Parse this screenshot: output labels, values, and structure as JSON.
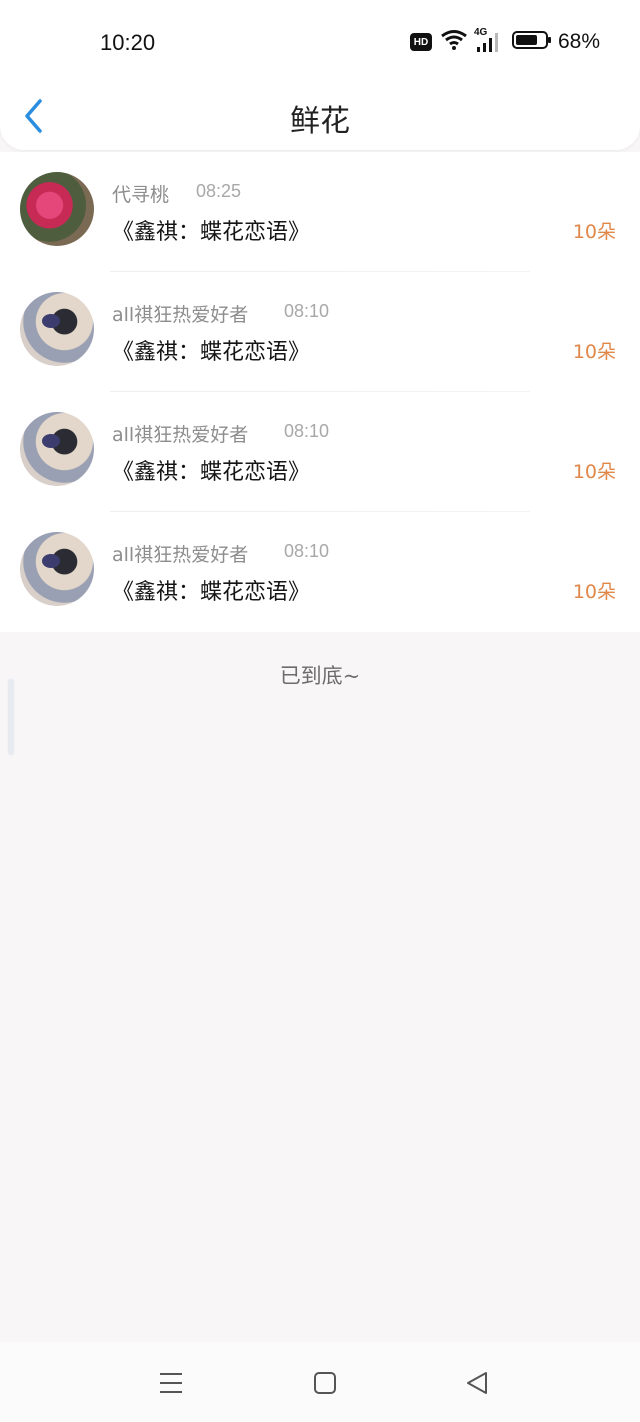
{
  "status_bar": {
    "time": "10:20",
    "hd_badge": "HD",
    "network": "4G",
    "battery": "68%",
    "icons": [
      "wifi-icon",
      "signal-icon",
      "battery-icon"
    ]
  },
  "header": {
    "back_icon": "chevron-left-icon",
    "title": "鲜花",
    "accent_color": "#2b8de0"
  },
  "records": [
    {
      "name": "代寻桃",
      "time": "08:25",
      "gift": "《鑫祺：蝶花恋语》",
      "count": "10朵",
      "avatar": "flower"
    },
    {
      "name": "all祺狂热爱好者",
      "time": "08:10",
      "gift": "《鑫祺：蝶花恋语》",
      "count": "10朵",
      "avatar": "photo"
    },
    {
      "name": "all祺狂热爱好者",
      "time": "08:10",
      "gift": "《鑫祺：蝶花恋语》",
      "count": "10朵",
      "avatar": "photo"
    },
    {
      "name": "all祺狂热爱好者",
      "time": "08:10",
      "gift": "《鑫祺：蝶花恋语》",
      "count": "10朵",
      "avatar": "photo"
    }
  ],
  "footer_tip": "已到底~",
  "nav_bar": {
    "items": [
      "menu-icon",
      "home-square-icon",
      "back-triangle-icon"
    ]
  },
  "colors": {
    "count": "#e0874a",
    "name": "#8d8d8d",
    "background": "#f8f6f7"
  }
}
